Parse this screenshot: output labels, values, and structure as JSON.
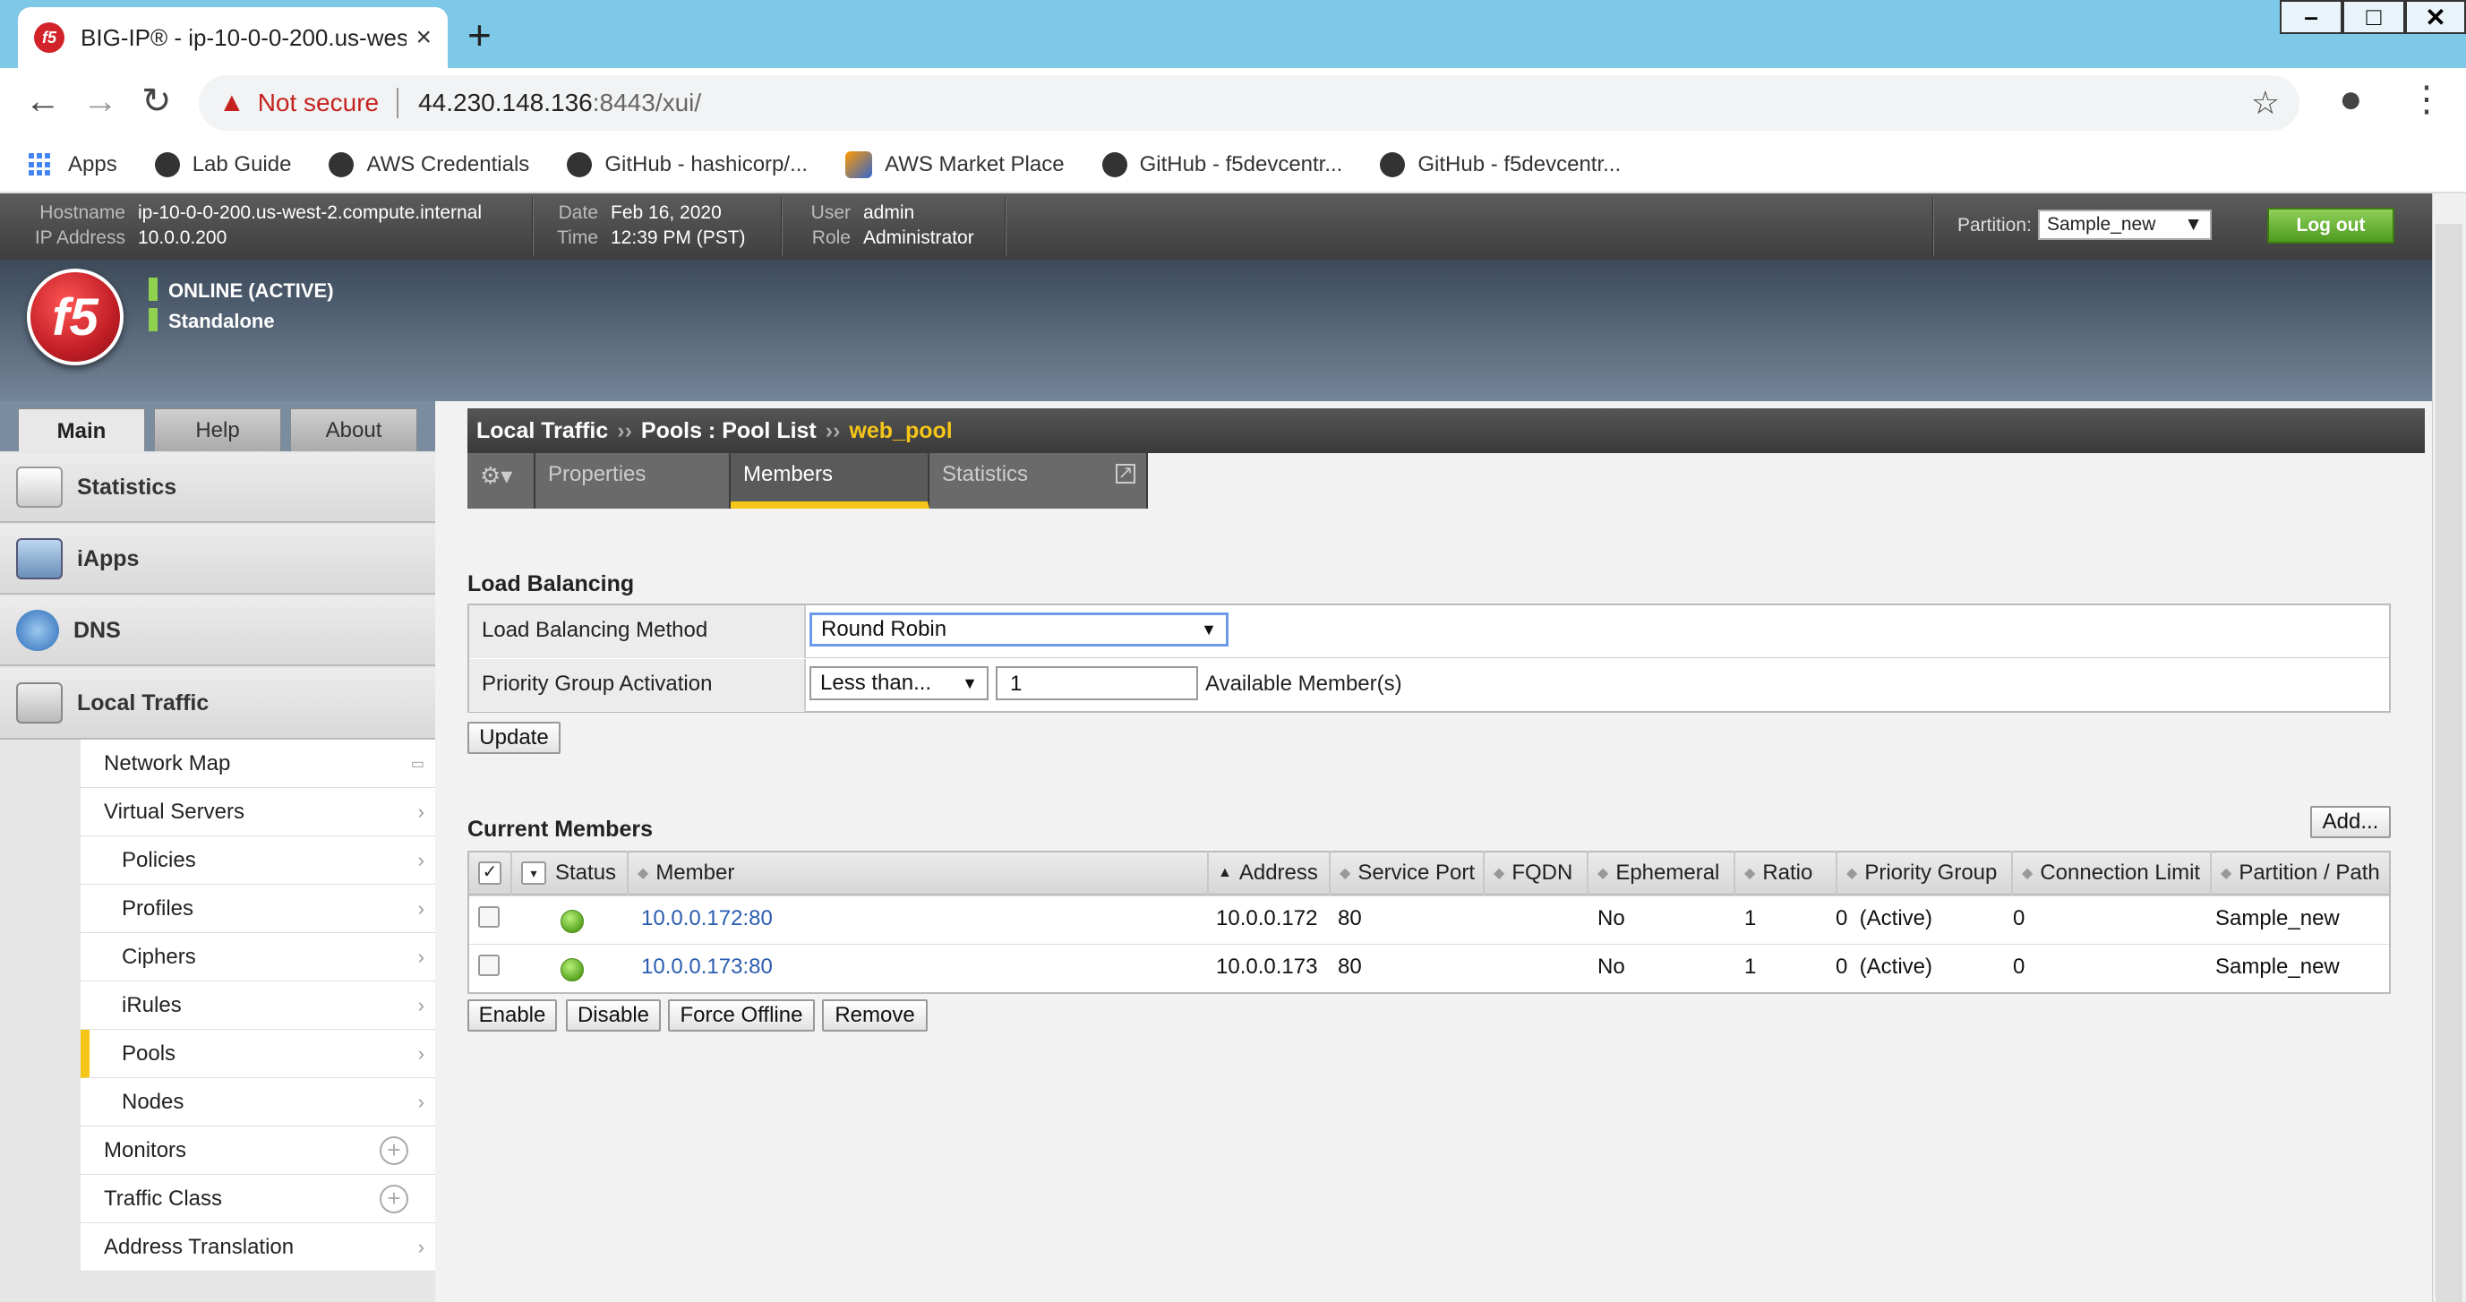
{
  "browser": {
    "tab_title": "BIG-IP® - ip-10-0-0-200.us-west",
    "tab_close": "×",
    "new_tab": "+",
    "not_secure": "Not secure",
    "url_host": "44.230.148.136",
    "url_path": ":8443/xui/",
    "bookmarks": [
      "Apps",
      "Lab Guide",
      "AWS Credentials",
      "GitHub - hashicorp/...",
      "AWS Market Place",
      "GitHub - f5devcentr...",
      "GitHub - f5devcentr..."
    ]
  },
  "header": {
    "hostname_label": "Hostname",
    "hostname": "ip-10-0-0-200.us-west-2.compute.internal",
    "ip_label": "IP Address",
    "ip": "10.0.0.200",
    "date_label": "Date",
    "date": "Feb 16, 2020",
    "time_label": "Time",
    "time": "12:39 PM (PST)",
    "user_label": "User",
    "user": "admin",
    "role_label": "Role",
    "role": "Administrator",
    "partition_label": "Partition:",
    "partition": "Sample_new",
    "logout": "Log out"
  },
  "status": {
    "line1": "ONLINE (ACTIVE)",
    "line2": "Standalone",
    "logo": "f5"
  },
  "sidebar": {
    "tabs": [
      "Main",
      "Help",
      "About"
    ],
    "sections": [
      "Statistics",
      "iApps",
      "DNS",
      "Local Traffic"
    ],
    "items": [
      "Network Map",
      "Virtual Servers",
      "Policies",
      "Profiles",
      "Ciphers",
      "iRules",
      "Pools",
      "Nodes",
      "Monitors",
      "Traffic Class",
      "Address Translation"
    ]
  },
  "breadcrumb": {
    "part1": "Local Traffic",
    "sep1": "››",
    "part2": "Pools : Pool List",
    "sep2": "››",
    "current": "web_pool"
  },
  "subtabs": [
    "Properties",
    "Members",
    "Statistics"
  ],
  "load_balancing": {
    "heading": "Load Balancing",
    "method_label": "Load Balancing Method",
    "method": "Round Robin",
    "pga_label": "Priority Group Activation",
    "pga": "Less than...",
    "pga_num": "1",
    "pga_suffix": "Available Member(s)",
    "update": "Update"
  },
  "members": {
    "heading": "Current Members",
    "add": "Add...",
    "columns": [
      "Status",
      "Member",
      "Address",
      "Service Port",
      "FQDN",
      "Ephemeral",
      "Ratio",
      "Priority Group",
      "Connection Limit",
      "Partition / Path"
    ],
    "rows": [
      {
        "member": "10.0.0.172:80",
        "address": "10.0.0.172",
        "port": "80",
        "fqdn": "",
        "ephemeral": "No",
        "ratio": "1",
        "priority": "0  (Active)",
        "conn": "0",
        "partition": "Sample_new"
      },
      {
        "member": "10.0.0.173:80",
        "address": "10.0.0.173",
        "port": "80",
        "fqdn": "",
        "ephemeral": "No",
        "ratio": "1",
        "priority": "0  (Active)",
        "conn": "0",
        "partition": "Sample_new"
      }
    ],
    "actions": [
      "Enable",
      "Disable",
      "Force Offline",
      "Remove"
    ]
  }
}
